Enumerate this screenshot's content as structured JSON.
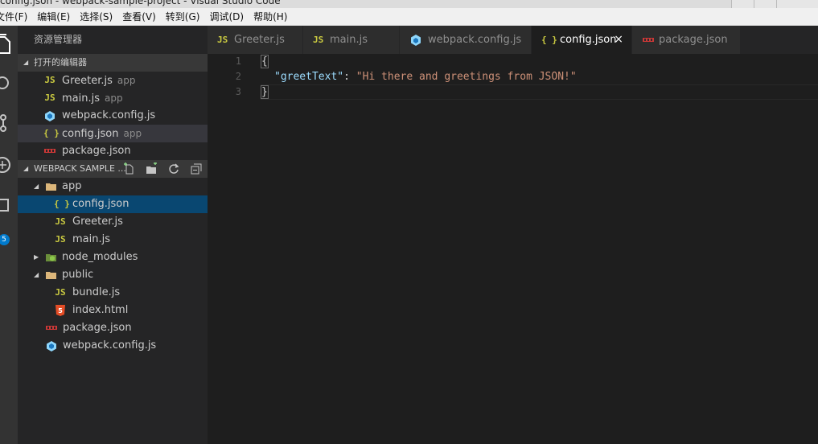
{
  "window": {
    "title": "config.json - webpack-sample-project - Visual Studio Code"
  },
  "menu": [
    "文件(F)",
    "编辑(E)",
    "选择(S)",
    "查看(V)",
    "转到(G)",
    "调试(D)",
    "帮助(H)"
  ],
  "activity": {
    "scm_badge": "5"
  },
  "sidebar": {
    "title": "资源管理器",
    "open_editors": {
      "header": "打开的编辑器",
      "items": [
        {
          "icon": "JS",
          "name": "Greeter.js",
          "hint": "app"
        },
        {
          "icon": "JS",
          "name": "main.js",
          "hint": "app"
        },
        {
          "icon": "webpack",
          "name": "webpack.config.js",
          "hint": ""
        },
        {
          "icon": "{ }",
          "name": "config.json",
          "hint": "app"
        },
        {
          "icon": "npm",
          "name": "package.json",
          "hint": ""
        }
      ]
    },
    "project": {
      "header": "WEBPACK SAMPLE ...",
      "tree": [
        {
          "name": "app",
          "type": "folder",
          "open": true
        },
        {
          "name": "config.json",
          "icon": "{ }"
        },
        {
          "name": "Greeter.js",
          "icon": "JS"
        },
        {
          "name": "main.js",
          "icon": "JS"
        },
        {
          "name": "node_modules",
          "type": "folder",
          "open": false
        },
        {
          "name": "public",
          "type": "folder",
          "open": true
        },
        {
          "name": "bundle.js",
          "icon": "JS"
        },
        {
          "name": "index.html",
          "icon": "5"
        },
        {
          "name": "package.json",
          "icon": "npm"
        },
        {
          "name": "webpack.config.js",
          "icon": "webpack"
        }
      ]
    }
  },
  "tabs": [
    {
      "icon": "JS",
      "label": "Greeter.js"
    },
    {
      "icon": "JS",
      "label": "main.js"
    },
    {
      "icon": "webpack",
      "label": "webpack.config.js"
    },
    {
      "icon": "{ }",
      "label": "config.json",
      "active": true,
      "close": "×"
    },
    {
      "icon": "npm",
      "label": "package.json"
    }
  ],
  "editor": {
    "line_numbers": [
      "1",
      "2",
      "3"
    ],
    "lines": {
      "l1": "{",
      "l2_key": "\"greetText\"",
      "l2_colon": ": ",
      "l2_value": "\"Hi there and greetings from JSON!\"",
      "l3": "}"
    }
  },
  "colors": {
    "js_icon": "#cbcb41",
    "json_string_key": "#9cdcfe",
    "json_string_value": "#ce9178",
    "selection_blue": "#094771",
    "badge_blue": "#007acc"
  }
}
